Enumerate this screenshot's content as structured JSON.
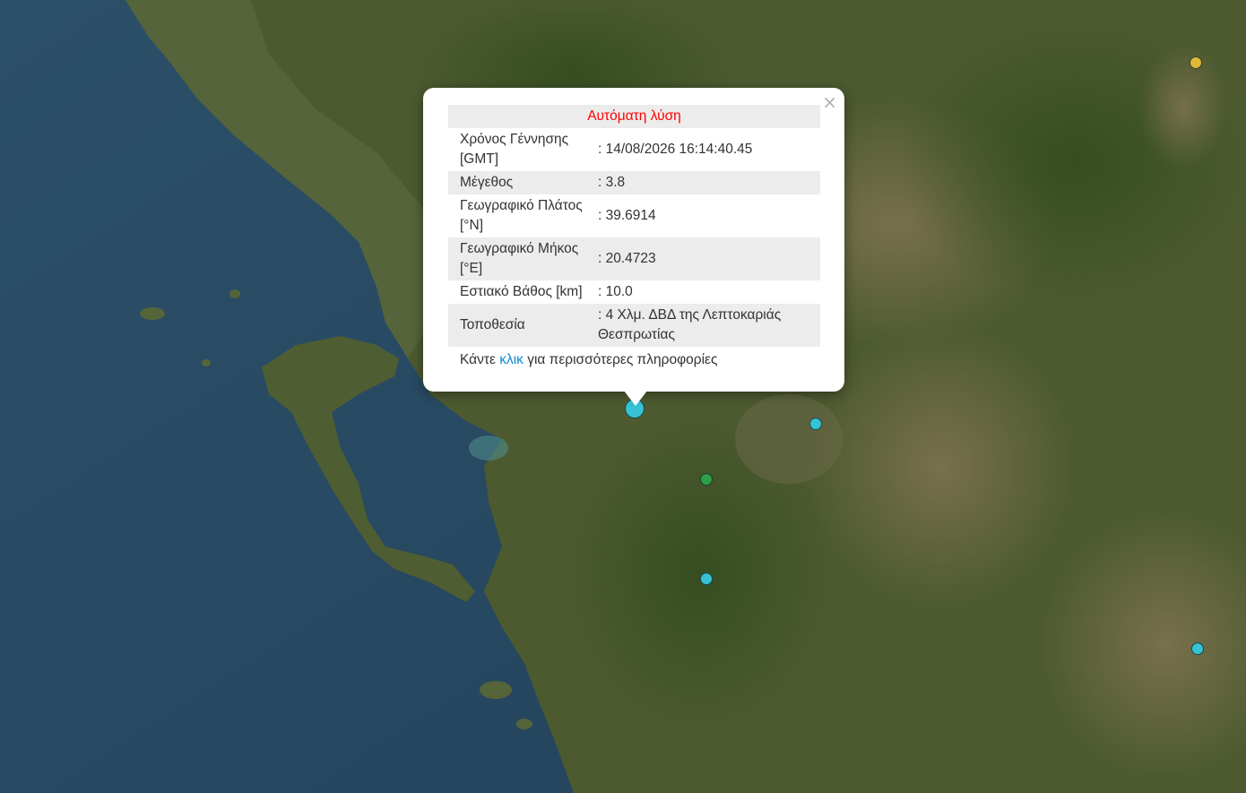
{
  "popup": {
    "title": "Αυτόματη λύση",
    "close_symbol": "×",
    "rows": [
      {
        "label": "Χρόνος Γέννησης [GMT]",
        "value": ": 14/08/2026 16:14:40.45"
      },
      {
        "label": "Μέγεθος",
        "value": ": 3.8"
      },
      {
        "label": "Γεωγραφικό Πλάτος [°N]",
        "value": ": 39.6914"
      },
      {
        "label": "Γεωγραφικό Μήκος [°E]",
        "value": ": 20.4723"
      },
      {
        "label": "Εστιακό Βάθος [km]",
        "value": ": 10.0"
      },
      {
        "label": "Τοποθεσία",
        "value": ": 4 Χλμ. ΔΒΔ της Λεπτοκαριάς Θεσπρωτίας"
      }
    ],
    "more": {
      "prefix": "Κάντε ",
      "link": "κλικ",
      "suffix": " για περισσότερες πληροφορίες"
    }
  },
  "colors": {
    "sea": "#2a4b63",
    "land": "#4a5a32",
    "marker_cyan": "#36c2d4",
    "marker_green": "#2e9e48",
    "marker_yellow": "#e0b838",
    "title_red": "#ff0000",
    "link_blue": "#0a8ad0"
  },
  "markers": [
    {
      "name": "selected-earthquake-marker",
      "color": "#36c2d4"
    },
    {
      "name": "earthquake-marker",
      "color": "#36c2d4"
    },
    {
      "name": "earthquake-marker",
      "color": "#2e9e48"
    },
    {
      "name": "earthquake-marker",
      "color": "#36c2d4"
    },
    {
      "name": "earthquake-marker",
      "color": "#36c2d4"
    },
    {
      "name": "earthquake-marker",
      "color": "#e0b838"
    }
  ]
}
